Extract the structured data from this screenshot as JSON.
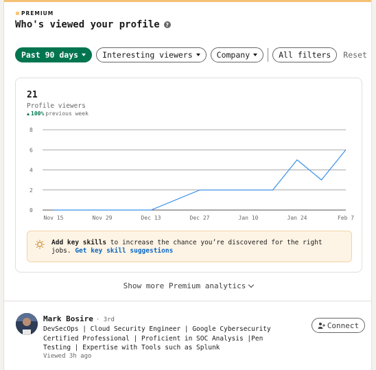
{
  "header": {
    "premium_label": "PREMIUM",
    "title": "Who's viewed your profile",
    "help_icon": "?"
  },
  "filters": {
    "items": [
      {
        "label": "Past 90 days",
        "active": true
      },
      {
        "label": "Interesting viewers",
        "active": false
      },
      {
        "label": "Company",
        "active": false
      }
    ],
    "all_filters_label": "All filters",
    "reset_label": "Reset"
  },
  "stats": {
    "count": "21",
    "label": "Profile viewers",
    "change_value": "100%",
    "change_text": "previous week"
  },
  "chart_data": {
    "type": "line",
    "x": [
      "Nov 15",
      "Nov 29",
      "Dec 13",
      "Dec 27",
      "Jan 10",
      "Jan 24",
      "Feb 7"
    ],
    "y_ticks": [
      8,
      6,
      4,
      2,
      0
    ],
    "ylim": [
      0,
      8
    ],
    "grid": true,
    "series": [
      {
        "values": [
          0,
          0,
          0,
          0,
          0,
          0,
          0,
          0,
          0,
          0,
          1,
          2,
          2,
          2,
          2,
          2,
          5,
          3,
          6
        ],
        "x_index": [
          0,
          0.5,
          1,
          1.5,
          2,
          2.5,
          3,
          3.5,
          4,
          4.5,
          2.5,
          3,
          3.5,
          4,
          4.5,
          4.5,
          5,
          5.5,
          6
        ],
        "color": "#378fe9"
      }
    ]
  },
  "tip": {
    "bold": "Add key skills",
    "text": " to increase the chance you’re discovered for the right jobs. ",
    "link": "Get key skill suggestions"
  },
  "show_more_label": "Show more Premium analytics",
  "viewer": {
    "name": "Mark Bosire",
    "degree": "· 3rd",
    "headline": "DevSecOps | Cloud Security Engineer | Google Cybersecurity Certified Professional | Proficient in SOC Analysis |Pen Testing | Expertise with Tools such as Splunk",
    "time": "Viewed 3h ago",
    "connect_label": "Connect"
  }
}
